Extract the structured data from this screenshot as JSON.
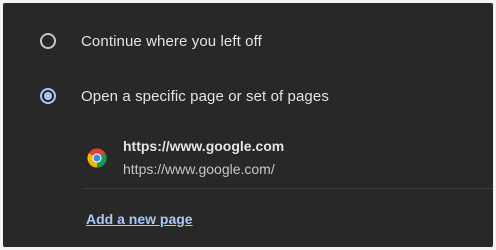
{
  "startup": {
    "options": [
      {
        "label": "Continue where you left off",
        "selected": false
      },
      {
        "label": "Open a specific page or set of pages",
        "selected": true
      }
    ],
    "pages": [
      {
        "title": "https://www.google.com",
        "url": "https://www.google.com/",
        "icon": "chrome-icon"
      }
    ],
    "add_page_label": "Add a new page"
  },
  "colors": {
    "background": "#282828",
    "accent": "#a8c7fa",
    "text": "#e3e3e3"
  }
}
